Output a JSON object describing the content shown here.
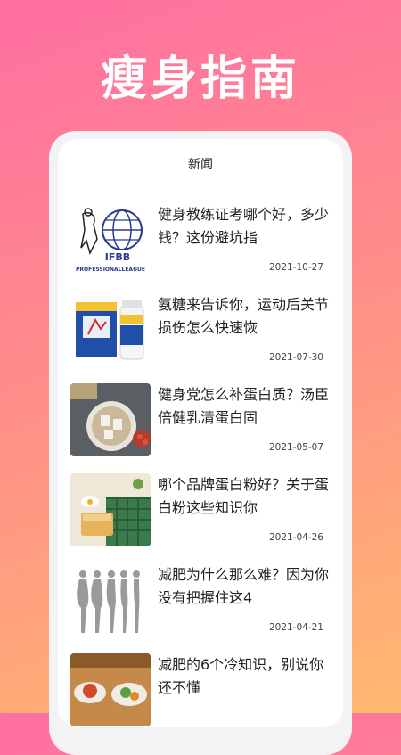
{
  "hero": {
    "title": "瘦身指南"
  },
  "screen": {
    "title": "新闻"
  },
  "news": [
    {
      "title": "健身教练证考哪个好，多少钱？这份避坑指",
      "date": "2021-10-27",
      "thumb_text": "IFBB",
      "thumb_caption": "PROFESSIONALLEAGUE"
    },
    {
      "title": "氨糖来告诉你，运动后关节损伤怎么快速恢",
      "date": "2021-07-30"
    },
    {
      "title": "健身党怎么补蛋白质？汤臣倍健乳清蛋白固",
      "date": "2021-05-07"
    },
    {
      "title": "哪个品牌蛋白粉好？关于蛋白粉这些知识你",
      "date": "2021-04-26"
    },
    {
      "title": "减肥为什么那么难？因为你没有把握住这4",
      "date": "2021-04-21"
    },
    {
      "title": "减肥的6个冷知识，别说你还不懂",
      "date": ""
    }
  ]
}
